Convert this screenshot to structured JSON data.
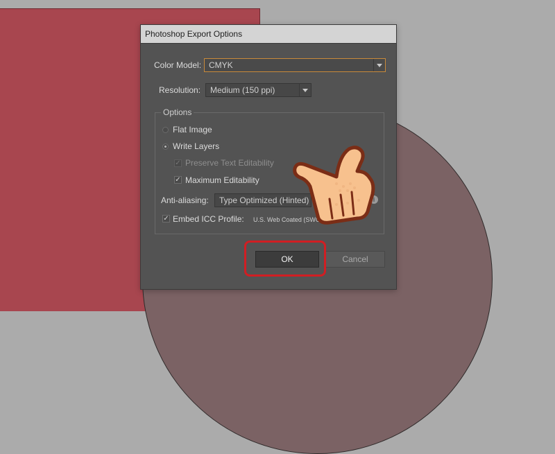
{
  "dialog": {
    "title": "Photoshop Export Options",
    "color_model": {
      "label": "Color Model:",
      "value": "CMYK"
    },
    "resolution": {
      "label": "Resolution:",
      "value": "Medium (150 ppi)"
    },
    "options": {
      "title": "Options",
      "flat_image": "Flat Image",
      "write_layers": "Write Layers",
      "preserve_text": "Preserve Text Editability",
      "max_edit": "Maximum Editability",
      "anti_alias": {
        "label": "Anti-aliasing:",
        "value": "Type Optimized (Hinted)"
      },
      "embed_icc": {
        "label": "Embed ICC Profile:",
        "value": "U.S. Web Coated (SWOP) v2"
      }
    },
    "buttons": {
      "ok": "OK",
      "cancel": "Cancel"
    }
  },
  "colors": {
    "highlight": "#d11e23",
    "focus": "#c98a3a"
  },
  "icons": {
    "pointer": "pointing-hand-icon",
    "info": "info-icon"
  }
}
